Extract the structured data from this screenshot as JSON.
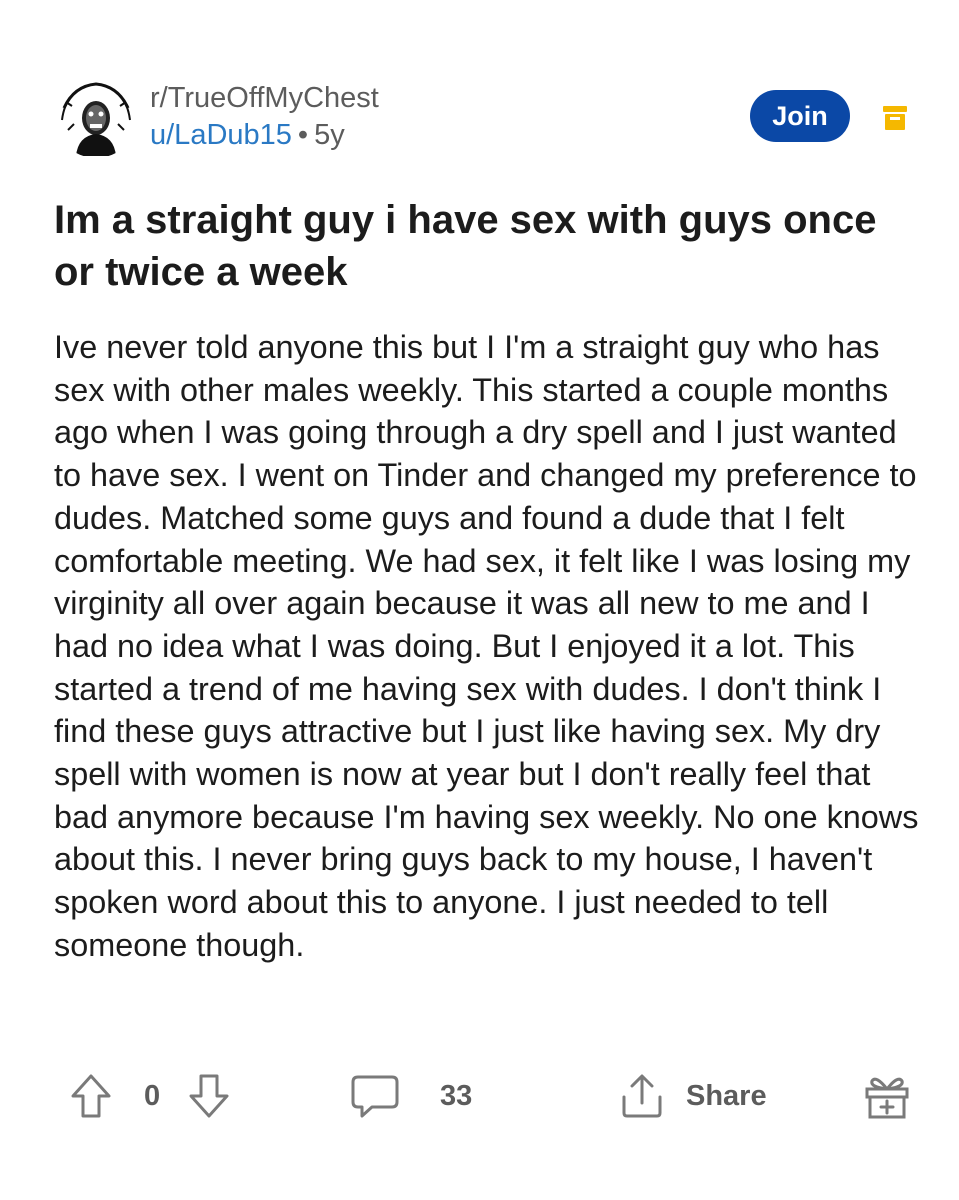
{
  "post": {
    "subreddit": "r/TrueOffMyChest",
    "username": "u/LaDub15",
    "separator": "•",
    "age": "5y",
    "join_label": "Join",
    "title": "Im a straight guy i have sex with guys once or twice a week",
    "body": "Ive never told anyone this but I I'm a straight guy who has sex with other males weekly. This started a couple months ago when I was going through a dry spell and I just wanted to have sex. I went on Tinder and changed my preference to dudes. Matched some guys and found a dude that I felt comfortable meeting. We had sex, it felt like I was losing my virginity all over again because it was all new to me and I had no idea what I was doing. But I enjoyed it a lot. This started a trend of me having sex with dudes. I don't think I find these guys attractive but I just like having sex. My dry spell with women is now at year but I don't really feel that bad anymore because I'm having sex weekly. No one knows about this. I never bring guys back to my house, I haven't spoken word about this to anyone. I just needed to tell someone though."
  },
  "actions": {
    "vote_count": "0",
    "comment_count": "33",
    "share_label": "Share"
  },
  "icons": {
    "avatar": "subreddit-avatar",
    "archive": "archive-icon",
    "upvote": "upvote-icon",
    "downvote": "downvote-icon",
    "comment": "comment-icon",
    "share": "share-icon",
    "award": "award-icon"
  },
  "colors": {
    "join_button": "#0b48a6",
    "username": "#2a79c4",
    "archive_icon": "#f5b800",
    "muted": "#5c5c5c"
  }
}
